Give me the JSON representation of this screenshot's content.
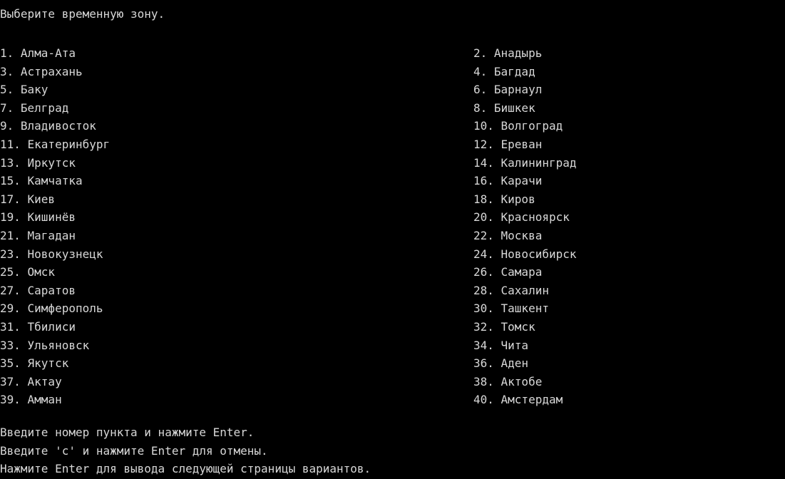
{
  "header": {
    "title": "Выберите временную зону."
  },
  "options": [
    {
      "left": "1. Алма-Ата",
      "right": "2. Анадырь"
    },
    {
      "left": "3. Астрахань",
      "right": "4. Багдад"
    },
    {
      "left": "5. Баку",
      "right": "6. Барнаул"
    },
    {
      "left": "7. Белград",
      "right": "8. Бишкек"
    },
    {
      "left": "9. Владивосток",
      "right": "10. Волгоград"
    },
    {
      "left": "11. Екатеринбург",
      "right": "12. Ереван"
    },
    {
      "left": "13. Иркутск",
      "right": "14. Калининград"
    },
    {
      "left": "15. Камчатка",
      "right": "16. Карачи"
    },
    {
      "left": "17. Киев",
      "right": "18. Киров"
    },
    {
      "left": "19. Кишинёв",
      "right": "20. Красноярск"
    },
    {
      "left": "21. Магадан",
      "right": "22. Москва"
    },
    {
      "left": "23. Новокузнецк",
      "right": "24. Новосибирск"
    },
    {
      "left": "25. Омск",
      "right": "26. Самара"
    },
    {
      "left": "27. Саратов",
      "right": "28. Сахалин"
    },
    {
      "left": "29. Симферополь",
      "right": "30. Ташкент"
    },
    {
      "left": "31. Тбилиси",
      "right": "32. Томск"
    },
    {
      "left": "33. Ульяновск",
      "right": "34. Чита"
    },
    {
      "left": "35. Якутск",
      "right": "36. Аден"
    },
    {
      "left": "37. Актау",
      "right": "38. Актобе"
    },
    {
      "left": "39. Амман",
      "right": "40. Амстердам"
    }
  ],
  "footer": {
    "line1": "Введите номер пункта и нажмите Enter.",
    "line2": "Введите 'c' и нажмите Enter для отмены.",
    "line3": "Нажмите Enter для вывода следующей страницы вариантов."
  },
  "colors": {
    "background": "#000000",
    "text": "#d8d8d8"
  }
}
